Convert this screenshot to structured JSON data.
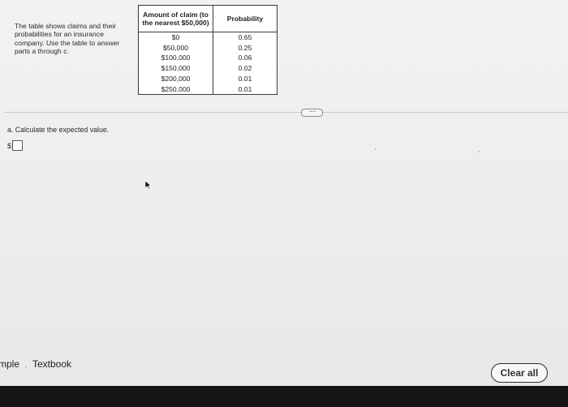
{
  "intro_text": "The table shows claims and their probabilities for an insurance company. Use the table to answer parts a through c.",
  "table": {
    "headers": [
      "Amount of claim (to the nearest $50,000)",
      "Probability"
    ],
    "rows": [
      [
        "$0",
        "0.65"
      ],
      [
        "$50,000",
        "0.25"
      ],
      [
        "$100,000",
        "0.06"
      ],
      [
        "$150,000",
        "0.02"
      ],
      [
        "$200,000",
        "0.01"
      ],
      [
        "$250,000",
        "0.01"
      ]
    ]
  },
  "more_button": "·····",
  "question": "a. Calculate the expected value.",
  "answer": {
    "prefix": "$",
    "value": ""
  },
  "footer": {
    "left_partial": "mple",
    "separator": ".",
    "textbook": "Textbook"
  },
  "clear_all_label": "Clear all",
  "colors": {
    "taskbar": "#151515",
    "button_border": "#2b2b2b"
  }
}
